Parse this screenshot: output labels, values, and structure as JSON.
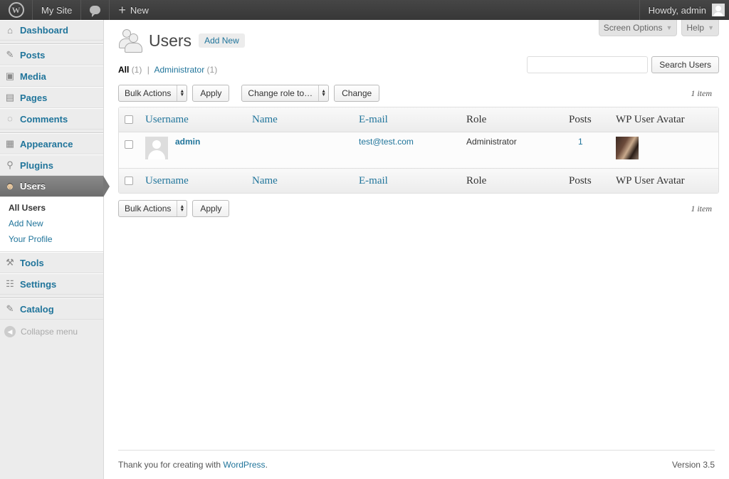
{
  "adminbar": {
    "site": "My Site",
    "new": "New",
    "howdy": "Howdy, admin"
  },
  "sidebar": {
    "items": [
      {
        "label": "Dashboard",
        "icon": "dashboard-icon"
      },
      {
        "label": "Posts",
        "icon": "pushpin-icon"
      },
      {
        "label": "Media",
        "icon": "media-icon"
      },
      {
        "label": "Pages",
        "icon": "pages-icon"
      },
      {
        "label": "Comments",
        "icon": "comments-icon"
      },
      {
        "label": "Appearance",
        "icon": "appearance-icon"
      },
      {
        "label": "Plugins",
        "icon": "plugins-icon"
      },
      {
        "label": "Users",
        "icon": "users-icon"
      },
      {
        "label": "Tools",
        "icon": "tools-icon"
      },
      {
        "label": "Settings",
        "icon": "settings-icon"
      },
      {
        "label": "Catalog",
        "icon": "pushpin-icon"
      }
    ],
    "submenu": [
      "All Users",
      "Add New",
      "Your Profile"
    ],
    "collapse": "Collapse menu"
  },
  "screen_tabs": {
    "screen_options": "Screen Options",
    "help": "Help"
  },
  "page": {
    "title": "Users",
    "add_new": "Add New"
  },
  "filters": {
    "all": "All",
    "all_count": "(1)",
    "separator": "|",
    "admin": "Administrator",
    "admin_count": "(1)"
  },
  "search": {
    "value": "",
    "button": "Search Users"
  },
  "tablenav_top": {
    "bulk": "Bulk Actions",
    "apply": "Apply",
    "change_role": "Change role to…",
    "change": "Change",
    "count": "1 item"
  },
  "table": {
    "columns": [
      "Username",
      "Name",
      "E-mail",
      "Role",
      "Posts",
      "WP User Avatar"
    ],
    "rows": [
      {
        "username": "admin",
        "name": "",
        "email": "test@test.com",
        "role": "Administrator",
        "posts": "1"
      }
    ]
  },
  "tablenav_bottom": {
    "bulk": "Bulk Actions",
    "apply": "Apply",
    "count": "1 item"
  },
  "footer": {
    "thanks": "Thank you for creating with",
    "wp": "WordPress",
    "period": ".",
    "version": "Version 3.5"
  },
  "colors": {
    "link": "#21759b",
    "adminbar": "#464646",
    "current_menu": "#777777"
  }
}
